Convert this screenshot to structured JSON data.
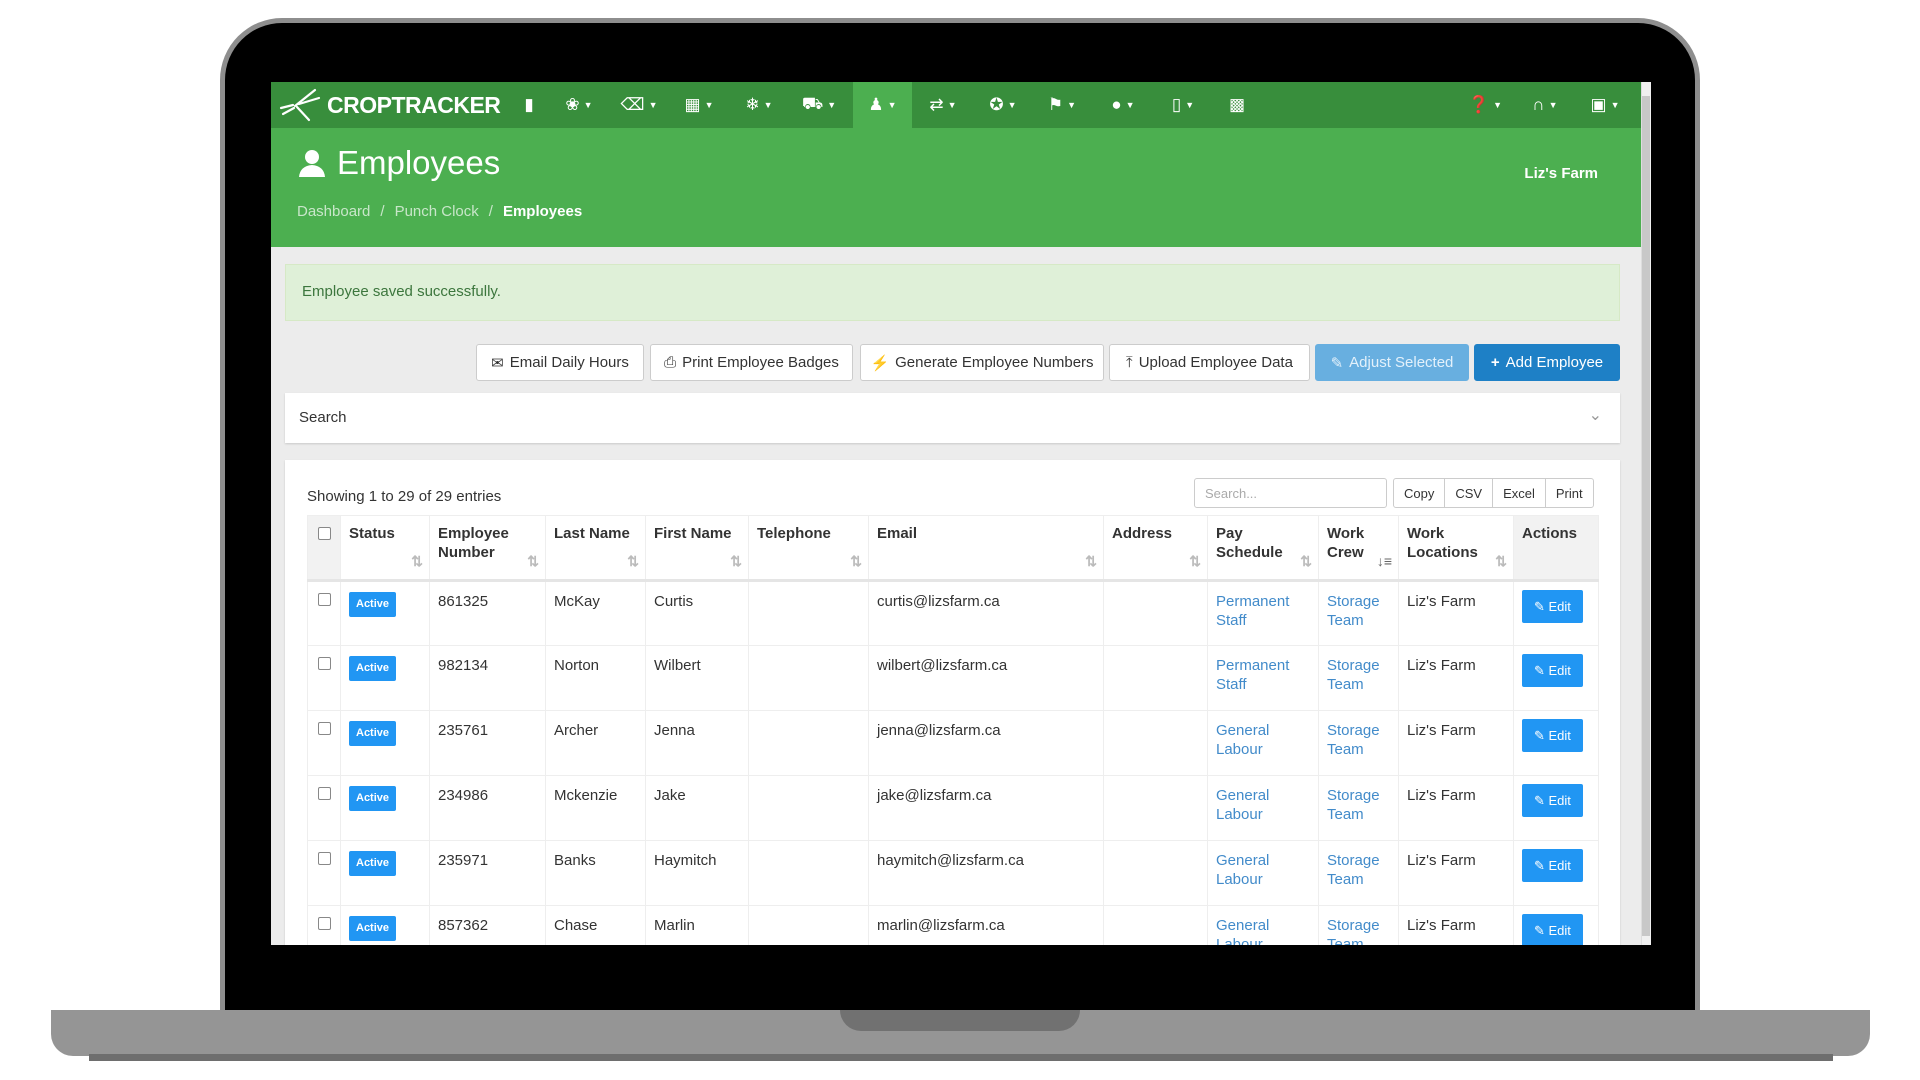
{
  "app": {
    "brand": "CROPTRACKER",
    "farm": "Liz's Farm"
  },
  "nav": {
    "left_icons": [
      "bookmark-icon",
      "leaf-icon",
      "basket-icon",
      "building-icon",
      "snowflake-icon",
      "truck-icon",
      "user-icon",
      "exchange-icon",
      "award-icon",
      "flag-icon",
      "tree-icon",
      "mobile-icon",
      "bar-chart-icon"
    ],
    "right_icons": [
      "question-icon",
      "headset-icon",
      "briefcase-icon"
    ],
    "active": "user-icon"
  },
  "page": {
    "title": "Employees",
    "breadcrumb": [
      "Dashboard",
      "Punch Clock",
      "Employees"
    ]
  },
  "alert": {
    "message": "Employee saved successfully."
  },
  "toolbar": {
    "email": "Email Daily Hours",
    "print": "Print Employee Badges",
    "generate": "Generate Employee Numbers",
    "upload": "Upload Employee Data",
    "adjust": "Adjust Selected",
    "add": "Add Employee"
  },
  "search_panel": {
    "label": "Search"
  },
  "table": {
    "info": "Showing 1 to 29 of 29 entries",
    "search_placeholder": "Search...",
    "export": [
      "Copy",
      "CSV",
      "Excel",
      "Print"
    ],
    "columns": [
      "Status",
      "Employee Number",
      "Last Name",
      "First Name",
      "Telephone",
      "Email",
      "Address",
      "Pay Schedule",
      "Work Crew",
      "Work Locations",
      "Actions"
    ],
    "sorted_column": "Work Crew",
    "rows": [
      {
        "status": "Active",
        "number": "861325",
        "last": "McKay",
        "first": "Curtis",
        "phone": "",
        "email": "curtis@lizsfarm.ca",
        "address": "",
        "pay": "Permanent Staff",
        "crew": "Storage Team",
        "location": "Liz's Farm",
        "action": "Edit"
      },
      {
        "status": "Active",
        "number": "982134",
        "last": "Norton",
        "first": "Wilbert",
        "phone": "",
        "email": "wilbert@lizsfarm.ca",
        "address": "",
        "pay": "Permanent Staff",
        "crew": "Storage Team",
        "location": "Liz's Farm",
        "action": "Edit"
      },
      {
        "status": "Active",
        "number": "235761",
        "last": "Archer",
        "first": "Jenna",
        "phone": "",
        "email": "jenna@lizsfarm.ca",
        "address": "",
        "pay": "General Labour",
        "crew": "Storage Team",
        "location": "Liz's Farm",
        "action": "Edit"
      },
      {
        "status": "Active",
        "number": "234986",
        "last": "Mckenzie",
        "first": "Jake",
        "phone": "",
        "email": "jake@lizsfarm.ca",
        "address": "",
        "pay": "General Labour",
        "crew": "Storage Team",
        "location": "Liz's Farm",
        "action": "Edit"
      },
      {
        "status": "Active",
        "number": "235971",
        "last": "Banks",
        "first": "Haymitch",
        "phone": "",
        "email": "haymitch@lizsfarm.ca",
        "address": "",
        "pay": "General Labour",
        "crew": "Storage Team",
        "location": "Liz's Farm",
        "action": "Edit"
      },
      {
        "status": "Active",
        "number": "857362",
        "last": "Chase",
        "first": "Marlin",
        "phone": "",
        "email": "marlin@lizsfarm.ca",
        "address": "",
        "pay": "General Labour",
        "crew": "Storage Team",
        "location": "Liz's Farm",
        "action": "Edit"
      }
    ]
  },
  "colors": {
    "nav": "#388e3c",
    "header": "#4caf50",
    "primary": "#1e80c6",
    "badge": "#2196f3",
    "link": "#428bca",
    "alert_bg": "#dff0d8",
    "alert_text": "#3c763d"
  }
}
